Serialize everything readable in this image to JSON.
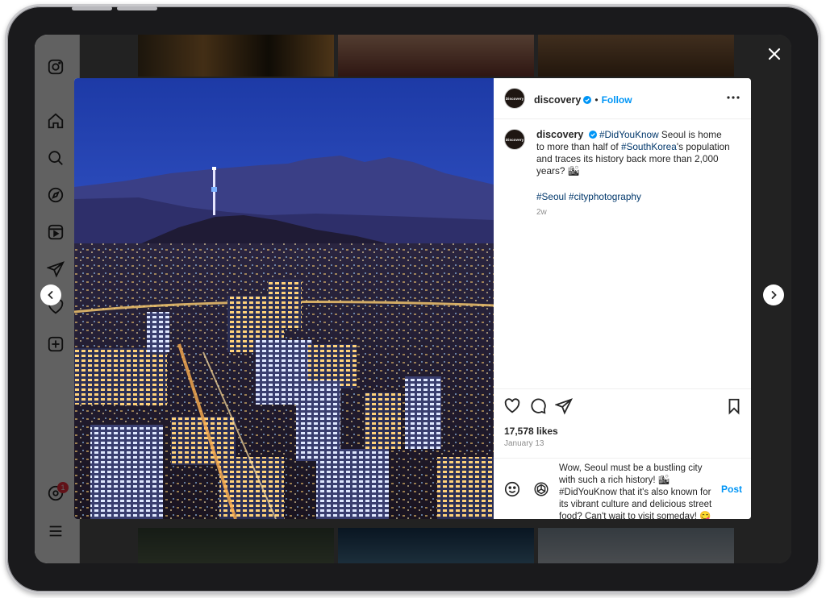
{
  "post": {
    "username": "discovery",
    "avatar_text": "Discovery",
    "follow_label": "Follow",
    "separator": "•",
    "caption_text_1": "Seoul is home to more than half of ",
    "caption_tag_1": "#DidYouKnow",
    "caption_tag_2": "#SouthKorea",
    "caption_text_2": "'s population and traces its history back more than 2,000 years? 🏙",
    "hashtags": "#Seoul #cityphotography",
    "age": "2w",
    "likes": "17,578 likes",
    "date": "January 13"
  },
  "comment_input": {
    "draft": "Wow, Seoul must be a bustling city with such a rich history! 🏙 #DidYouKnow that it's also known for its vibrant culture and delicious street food? Can't wait to visit someday! 😋",
    "post_label": "Post"
  },
  "nav": {
    "notification_count": "1"
  },
  "colors": {
    "accent": "#0095f6",
    "hashtag": "#00376b",
    "badge": "#ff3040"
  }
}
